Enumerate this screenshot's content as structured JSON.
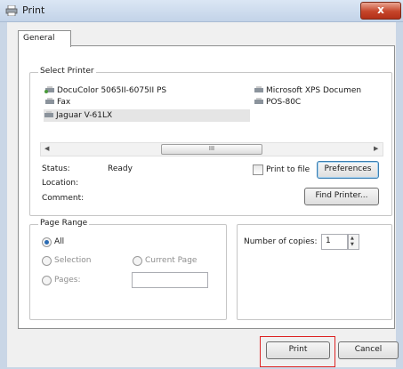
{
  "window": {
    "title": "Print",
    "close_glyph": "x"
  },
  "tabs": [
    {
      "label": "General"
    }
  ],
  "select_printer": {
    "label": "Select Printer",
    "printers": [
      {
        "name": "DocuColor 5065II-6075II PS",
        "icon": "printer-network-icon"
      },
      {
        "name": "Microsoft XPS Documen",
        "icon": "printer-icon"
      },
      {
        "name": "Fax",
        "icon": "fax-icon"
      },
      {
        "name": "POS-80C",
        "icon": "printer-icon"
      },
      {
        "name": "Jaguar V-61LX",
        "icon": "printer-icon",
        "selected": true
      }
    ],
    "scroll_thumb_glyph": "III",
    "status_label": "Status:",
    "status_value": "Ready",
    "location_label": "Location:",
    "comment_label": "Comment:",
    "print_to_file_label": "Print to file",
    "preferences_label": "Preferences",
    "find_printer_label": "Find Printer..."
  },
  "page_range": {
    "label": "Page Range",
    "all_label": "All",
    "selection_label": "Selection",
    "current_page_label": "Current Page",
    "pages_label": "Pages:",
    "pages_value": ""
  },
  "copies": {
    "label": "Number of copies:",
    "value": "1"
  },
  "buttons": {
    "print_label": "Print",
    "cancel_label": "Cancel"
  },
  "colors": {
    "highlight": "#dd2222",
    "selected_radio": "#2a6bb3",
    "focus_border": "#3c7fb1"
  }
}
